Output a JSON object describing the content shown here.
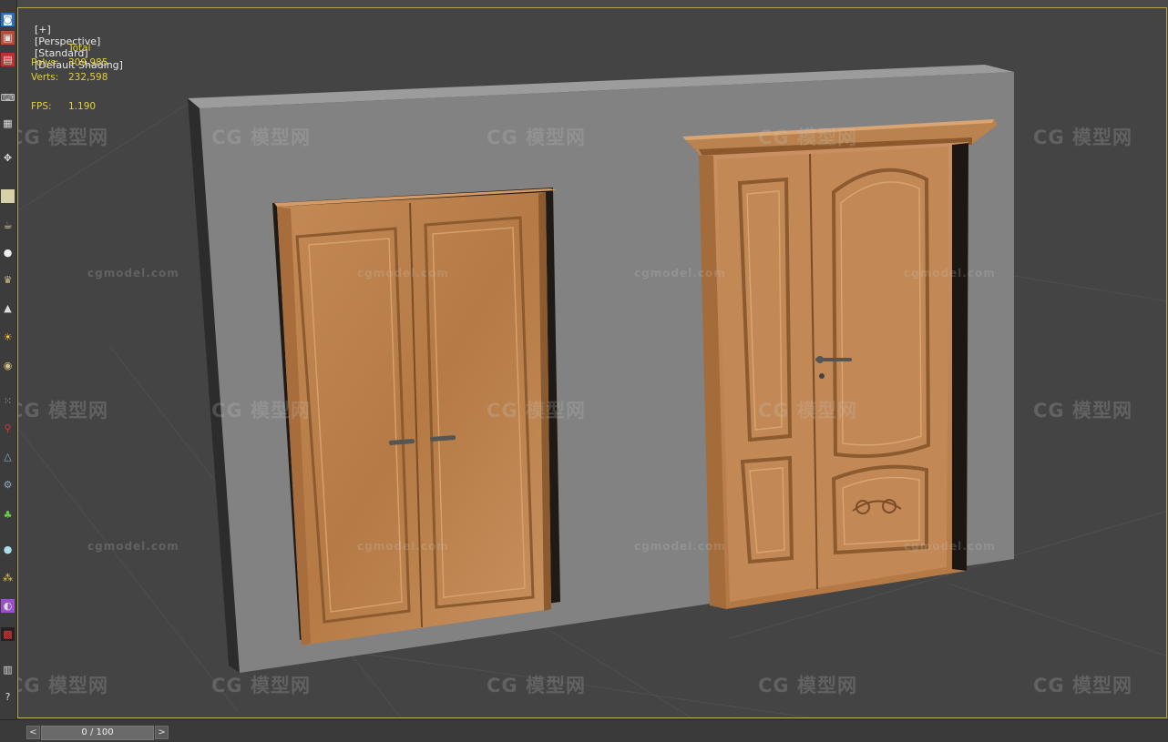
{
  "viewport": {
    "label_parts": [
      "[+]",
      "[Perspective]",
      "[Standard]",
      "[Default Shading]"
    ]
  },
  "stats": {
    "header": "Total",
    "polys_label": "Polys:",
    "polys_value": "309,985",
    "verts_label": "Verts:",
    "verts_value": "232,598",
    "fps_label": "FPS:",
    "fps_value": "1.190"
  },
  "timeline": {
    "frame_display": "0 / 100",
    "prev_label": "<",
    "next_label": ">"
  },
  "watermarks": {
    "cn_text": "模型网",
    "en_text": "cgmodel.com"
  },
  "toolbar_icons": [
    "viewcube-icon",
    "render-icon",
    "keyboard-icon",
    "grid-icon",
    "move-icon",
    "plane-icon",
    "teapot-icon",
    "sphere-icon",
    "cone-icon",
    "cylinder-icon",
    "sun-light-icon",
    "torus-icon",
    "particles-icon",
    "pin-icon",
    "tripod-icon",
    "gear-icon",
    "plant-icon",
    "material-ball-icon",
    "cluster-icon",
    "material-editor-icon",
    "render-frame-icon",
    "grid-small-icon",
    "help-icon"
  ],
  "colors": {
    "viewport_bg": "#444444",
    "viewport_border": "#b8a450",
    "stats_text": "#e2cf3c",
    "wall_front": "#808080",
    "wall_top": "#9a9a9a",
    "wood": "#c08752"
  }
}
